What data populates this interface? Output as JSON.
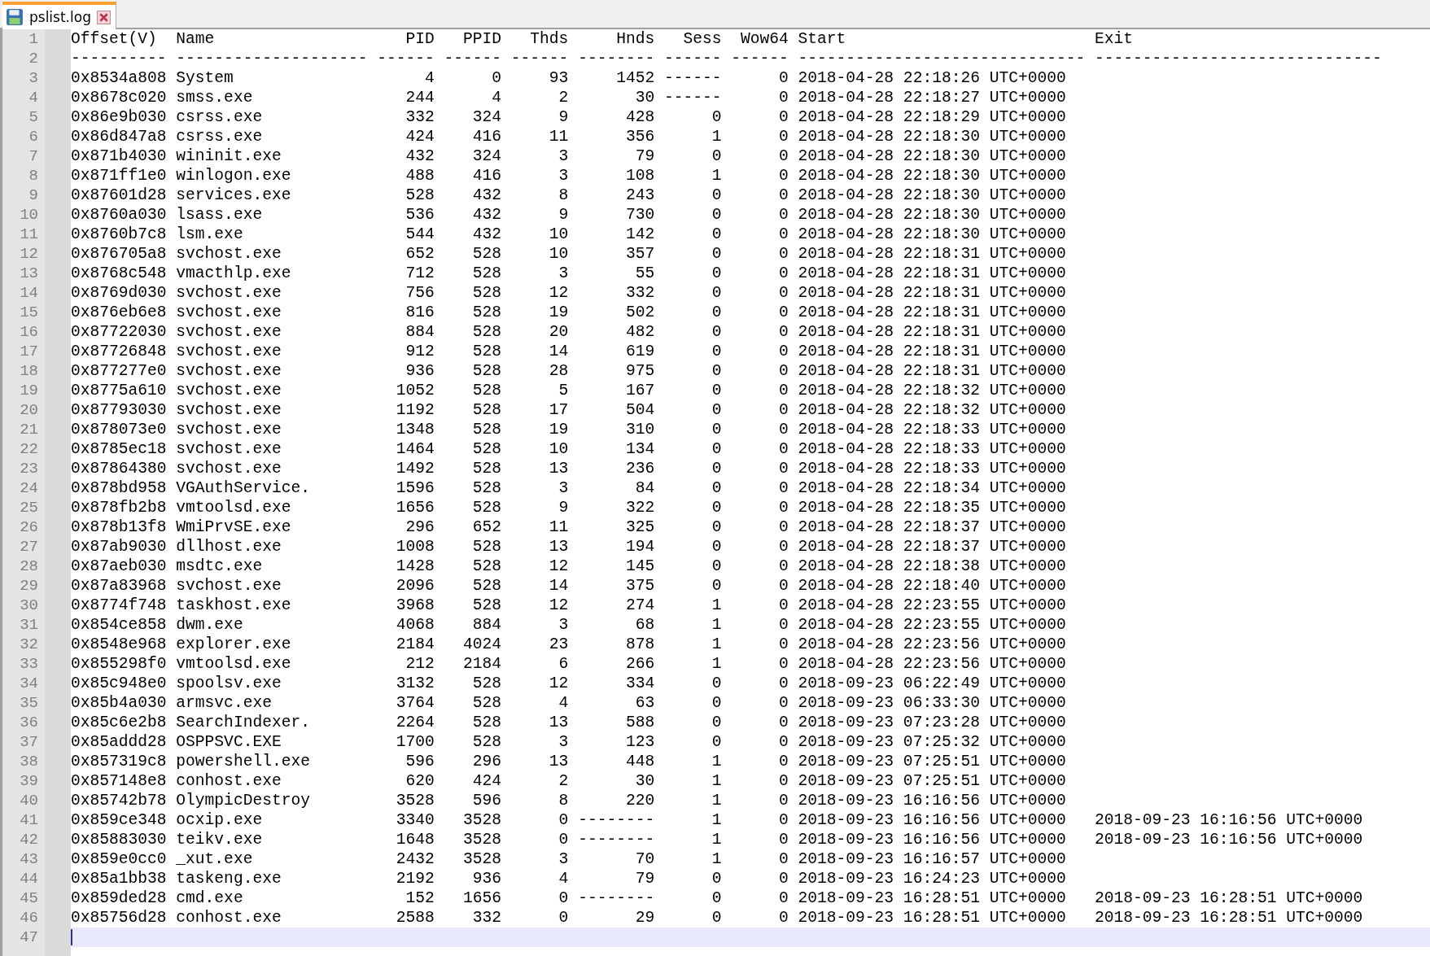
{
  "tab": {
    "title": "pslist.log",
    "selected": true
  },
  "lines": [
    {
      "number": "1",
      "selected": false,
      "cells": [
        "Offset(V)",
        "Name",
        "PID",
        "PPID",
        "Thds",
        "Hnds",
        "Sess",
        "Wow64",
        "Start",
        "Exit"
      ]
    },
    {
      "number": "2",
      "selected": false,
      "cells": [
        "----------",
        "--------------------",
        "------",
        "------",
        "------",
        "--------",
        "------",
        "------",
        "------------------------------",
        "------------------------------"
      ]
    },
    {
      "number": "3",
      "selected": false,
      "cells": [
        "0x8534a808",
        "System",
        "4",
        "0",
        "93",
        "1452",
        "------",
        "0",
        "2018-04-28 22:18:26 UTC+0000"
      ]
    },
    {
      "number": "4",
      "selected": false,
      "cells": [
        "0x8678c020",
        "smss.exe",
        "244",
        "4",
        "2",
        "30",
        "------",
        "0",
        "2018-04-28 22:18:27 UTC+0000"
      ]
    },
    {
      "number": "5",
      "selected": false,
      "cells": [
        "0x86e9b030",
        "csrss.exe",
        "332",
        "324",
        "9",
        "428",
        "0",
        "0",
        "2018-04-28 22:18:29 UTC+0000"
      ]
    },
    {
      "number": "6",
      "selected": false,
      "cells": [
        "0x86d847a8",
        "csrss.exe",
        "424",
        "416",
        "11",
        "356",
        "1",
        "0",
        "2018-04-28 22:18:30 UTC+0000"
      ]
    },
    {
      "number": "7",
      "selected": false,
      "cells": [
        "0x871b4030",
        "wininit.exe",
        "432",
        "324",
        "3",
        "79",
        "0",
        "0",
        "2018-04-28 22:18:30 UTC+0000"
      ]
    },
    {
      "number": "8",
      "selected": false,
      "cells": [
        "0x871ff1e0",
        "winlogon.exe",
        "488",
        "416",
        "3",
        "108",
        "1",
        "0",
        "2018-04-28 22:18:30 UTC+0000"
      ]
    },
    {
      "number": "9",
      "selected": false,
      "cells": [
        "0x87601d28",
        "services.exe",
        "528",
        "432",
        "8",
        "243",
        "0",
        "0",
        "2018-04-28 22:18:30 UTC+0000"
      ]
    },
    {
      "number": "10",
      "selected": false,
      "cells": [
        "0x8760a030",
        "lsass.exe",
        "536",
        "432",
        "9",
        "730",
        "0",
        "0",
        "2018-04-28 22:18:30 UTC+0000"
      ]
    },
    {
      "number": "11",
      "selected": false,
      "cells": [
        "0x8760b7c8",
        "lsm.exe",
        "544",
        "432",
        "10",
        "142",
        "0",
        "0",
        "2018-04-28 22:18:30 UTC+0000"
      ]
    },
    {
      "number": "12",
      "selected": false,
      "cells": [
        "0x876705a8",
        "svchost.exe",
        "652",
        "528",
        "10",
        "357",
        "0",
        "0",
        "2018-04-28 22:18:31 UTC+0000"
      ]
    },
    {
      "number": "13",
      "selected": false,
      "cells": [
        "0x8768c548",
        "vmacthlp.exe",
        "712",
        "528",
        "3",
        "55",
        "0",
        "0",
        "2018-04-28 22:18:31 UTC+0000"
      ]
    },
    {
      "number": "14",
      "selected": false,
      "cells": [
        "0x8769d030",
        "svchost.exe",
        "756",
        "528",
        "12",
        "332",
        "0",
        "0",
        "2018-04-28 22:18:31 UTC+0000"
      ]
    },
    {
      "number": "15",
      "selected": false,
      "cells": [
        "0x876eb6e8",
        "svchost.exe",
        "816",
        "528",
        "19",
        "502",
        "0",
        "0",
        "2018-04-28 22:18:31 UTC+0000"
      ]
    },
    {
      "number": "16",
      "selected": false,
      "cells": [
        "0x87722030",
        "svchost.exe",
        "884",
        "528",
        "20",
        "482",
        "0",
        "0",
        "2018-04-28 22:18:31 UTC+0000"
      ]
    },
    {
      "number": "17",
      "selected": false,
      "cells": [
        "0x87726848",
        "svchost.exe",
        "912",
        "528",
        "14",
        "619",
        "0",
        "0",
        "2018-04-28 22:18:31 UTC+0000"
      ]
    },
    {
      "number": "18",
      "selected": false,
      "cells": [
        "0x877277e0",
        "svchost.exe",
        "936",
        "528",
        "28",
        "975",
        "0",
        "0",
        "2018-04-28 22:18:31 UTC+0000"
      ]
    },
    {
      "number": "19",
      "selected": false,
      "cells": [
        "0x8775a610",
        "svchost.exe",
        "1052",
        "528",
        "5",
        "167",
        "0",
        "0",
        "2018-04-28 22:18:32 UTC+0000"
      ]
    },
    {
      "number": "20",
      "selected": false,
      "cells": [
        "0x87793030",
        "svchost.exe",
        "1192",
        "528",
        "17",
        "504",
        "0",
        "0",
        "2018-04-28 22:18:32 UTC+0000"
      ]
    },
    {
      "number": "21",
      "selected": false,
      "cells": [
        "0x878073e0",
        "svchost.exe",
        "1348",
        "528",
        "19",
        "310",
        "0",
        "0",
        "2018-04-28 22:18:33 UTC+0000"
      ]
    },
    {
      "number": "22",
      "selected": false,
      "cells": [
        "0x8785ec18",
        "svchost.exe",
        "1464",
        "528",
        "10",
        "134",
        "0",
        "0",
        "2018-04-28 22:18:33 UTC+0000"
      ]
    },
    {
      "number": "23",
      "selected": false,
      "cells": [
        "0x87864380",
        "svchost.exe",
        "1492",
        "528",
        "13",
        "236",
        "0",
        "0",
        "2018-04-28 22:18:33 UTC+0000"
      ]
    },
    {
      "number": "24",
      "selected": false,
      "cells": [
        "0x878bd958",
        "VGAuthService.",
        "1596",
        "528",
        "3",
        "84",
        "0",
        "0",
        "2018-04-28 22:18:34 UTC+0000"
      ]
    },
    {
      "number": "25",
      "selected": false,
      "cells": [
        "0x878fb2b8",
        "vmtoolsd.exe",
        "1656",
        "528",
        "9",
        "322",
        "0",
        "0",
        "2018-04-28 22:18:35 UTC+0000"
      ]
    },
    {
      "number": "26",
      "selected": false,
      "cells": [
        "0x878b13f8",
        "WmiPrvSE.exe",
        "296",
        "652",
        "11",
        "325",
        "0",
        "0",
        "2018-04-28 22:18:37 UTC+0000"
      ]
    },
    {
      "number": "27",
      "selected": false,
      "cells": [
        "0x87ab9030",
        "dllhost.exe",
        "1008",
        "528",
        "13",
        "194",
        "0",
        "0",
        "2018-04-28 22:18:37 UTC+0000"
      ]
    },
    {
      "number": "28",
      "selected": false,
      "cells": [
        "0x87aeb030",
        "msdtc.exe",
        "1428",
        "528",
        "12",
        "145",
        "0",
        "0",
        "2018-04-28 22:18:38 UTC+0000"
      ]
    },
    {
      "number": "29",
      "selected": false,
      "cells": [
        "0x87a83968",
        "svchost.exe",
        "2096",
        "528",
        "14",
        "375",
        "0",
        "0",
        "2018-04-28 22:18:40 UTC+0000"
      ]
    },
    {
      "number": "30",
      "selected": false,
      "cells": [
        "0x8774f748",
        "taskhost.exe",
        "3968",
        "528",
        "12",
        "274",
        "1",
        "0",
        "2018-04-28 22:23:55 UTC+0000"
      ]
    },
    {
      "number": "31",
      "selected": false,
      "cells": [
        "0x854ce858",
        "dwm.exe",
        "4068",
        "884",
        "3",
        "68",
        "1",
        "0",
        "2018-04-28 22:23:55 UTC+0000"
      ]
    },
    {
      "number": "32",
      "selected": false,
      "cells": [
        "0x8548e968",
        "explorer.exe",
        "2184",
        "4024",
        "23",
        "878",
        "1",
        "0",
        "2018-04-28 22:23:56 UTC+0000"
      ]
    },
    {
      "number": "33",
      "selected": false,
      "cells": [
        "0x855298f0",
        "vmtoolsd.exe",
        "212",
        "2184",
        "6",
        "266",
        "1",
        "0",
        "2018-04-28 22:23:56 UTC+0000"
      ]
    },
    {
      "number": "34",
      "selected": false,
      "cells": [
        "0x85c948e0",
        "spoolsv.exe",
        "3132",
        "528",
        "12",
        "334",
        "0",
        "0",
        "2018-09-23 06:22:49 UTC+0000"
      ]
    },
    {
      "number": "35",
      "selected": false,
      "cells": [
        "0x85b4a030",
        "armsvc.exe",
        "3764",
        "528",
        "4",
        "63",
        "0",
        "0",
        "2018-09-23 06:33:30 UTC+0000"
      ]
    },
    {
      "number": "36",
      "selected": false,
      "cells": [
        "0x85c6e2b8",
        "SearchIndexer.",
        "2264",
        "528",
        "13",
        "588",
        "0",
        "0",
        "2018-09-23 07:23:28 UTC+0000"
      ]
    },
    {
      "number": "37",
      "selected": false,
      "cells": [
        "0x85addd28",
        "OSPPSVC.EXE",
        "1700",
        "528",
        "3",
        "123",
        "0",
        "0",
        "2018-09-23 07:25:32 UTC+0000"
      ]
    },
    {
      "number": "38",
      "selected": false,
      "cells": [
        "0x857319c8",
        "powershell.exe",
        "596",
        "296",
        "13",
        "448",
        "1",
        "0",
        "2018-09-23 07:25:51 UTC+0000"
      ]
    },
    {
      "number": "39",
      "selected": false,
      "cells": [
        "0x857148e8",
        "conhost.exe",
        "620",
        "424",
        "2",
        "30",
        "1",
        "0",
        "2018-09-23 07:25:51 UTC+0000"
      ]
    },
    {
      "number": "40",
      "selected": false,
      "cells": [
        "0x85742b78",
        "OlympicDestroy",
        "3528",
        "596",
        "8",
        "220",
        "1",
        "0",
        "2018-09-23 16:16:56 UTC+0000"
      ]
    },
    {
      "number": "41",
      "selected": false,
      "cells": [
        "0x859ce348",
        "ocxip.exe",
        "3340",
        "3528",
        "0",
        "--------",
        "1",
        "0",
        "2018-09-23 16:16:56 UTC+0000",
        "2018-09-23 16:16:56 UTC+0000"
      ]
    },
    {
      "number": "42",
      "selected": false,
      "cells": [
        "0x85883030",
        "teikv.exe",
        "1648",
        "3528",
        "0",
        "--------",
        "1",
        "0",
        "2018-09-23 16:16:56 UTC+0000",
        "2018-09-23 16:16:56 UTC+0000"
      ]
    },
    {
      "number": "43",
      "selected": false,
      "cells": [
        "0x859e0cc0",
        "_xut.exe",
        "2432",
        "3528",
        "3",
        "70",
        "1",
        "0",
        "2018-09-23 16:16:57 UTC+0000"
      ]
    },
    {
      "number": "44",
      "selected": false,
      "cells": [
        "0x85a1bb38",
        "taskeng.exe",
        "2192",
        "936",
        "4",
        "79",
        "0",
        "0",
        "2018-09-23 16:24:23 UTC+0000"
      ]
    },
    {
      "number": "45",
      "selected": false,
      "cells": [
        "0x859ded28",
        "cmd.exe",
        "152",
        "1656",
        "0",
        "--------",
        "0",
        "0",
        "2018-09-23 16:28:51 UTC+0000",
        "2018-09-23 16:28:51 UTC+0000"
      ]
    },
    {
      "number": "46",
      "selected": false,
      "cells": [
        "0x85756d28",
        "conhost.exe",
        "2588",
        "332",
        "0",
        "29",
        "0",
        "0",
        "2018-09-23 16:28:51 UTC+0000",
        "2018-09-23 16:28:51 UTC+0000"
      ]
    },
    {
      "number": "47",
      "selected": true
    }
  ]
}
